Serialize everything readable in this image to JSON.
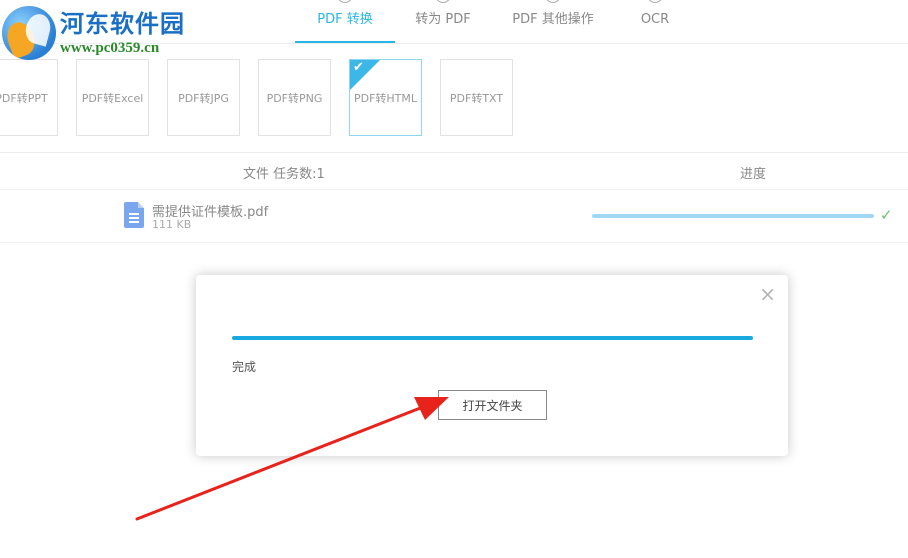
{
  "watermark": {
    "title": "河东软件园",
    "url": "www.pc0359.cn"
  },
  "tabs": [
    {
      "label": "PDF 转换",
      "active": true
    },
    {
      "label": "转为 PDF",
      "active": false
    },
    {
      "label": "PDF 其他操作",
      "active": false
    },
    {
      "label": "OCR",
      "active": false
    }
  ],
  "formats": [
    {
      "label": "PDF转PPT",
      "selected": false
    },
    {
      "label": "PDF转Excel",
      "selected": false
    },
    {
      "label": "PDF转JPG",
      "selected": false
    },
    {
      "label": "PDF转PNG",
      "selected": false
    },
    {
      "label": "PDF转HTML",
      "selected": true
    },
    {
      "label": "PDF转TXT",
      "selected": false
    }
  ],
  "table": {
    "file_header": "文件 任务数:1",
    "progress_header": "进度",
    "rows": [
      {
        "name": "需提供证件模板.pdf",
        "size": "111 KB",
        "progress": 1.0,
        "done": true
      }
    ]
  },
  "dialog": {
    "progress": 1.0,
    "status": "完成",
    "open_folder_label": "打开文件夹",
    "close_glyph": "×"
  },
  "colors": {
    "accent": "#29b6e6",
    "progress_done": "#19a8e0",
    "row_progress": "#9ed8f3",
    "check_green": "#6bc26b",
    "annotation_arrow": "#e8231b"
  }
}
